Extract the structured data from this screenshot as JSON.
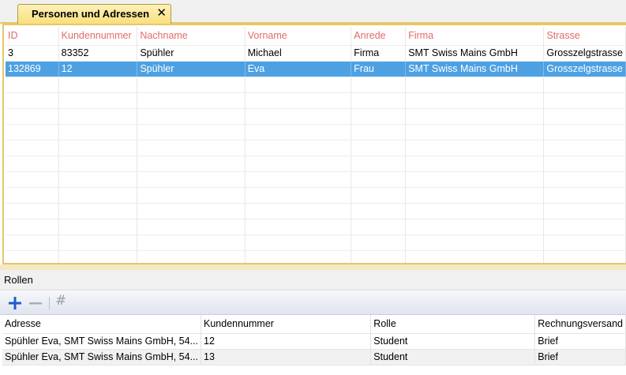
{
  "tab": {
    "title": "Personen und Adressen",
    "close_glyph": "✕"
  },
  "main_grid": {
    "columns": [
      "ID",
      "Kundennummer",
      "Nachname",
      "Vorname",
      "Anrede",
      "Firma",
      "Strasse"
    ],
    "rows": [
      [
        "3",
        "83352",
        "Spühler",
        "Michael",
        "Firma",
        "SMT Swiss Mains GmbH",
        "Grosszelgstrasse"
      ],
      [
        "132869",
        "12",
        "Spühler",
        "Eva",
        "Frau",
        "SMT Swiss Mains GmbH",
        "Grosszelgstrasse"
      ]
    ],
    "selected_row": 1
  },
  "roles_panel": {
    "title": "Rollen",
    "toolbar": {
      "add_icon": "plus-icon",
      "remove_icon": "minus-icon",
      "hash_icon": "hash-icon",
      "hash_glyph": "#"
    },
    "columns": [
      "Adresse",
      "Kundennummer",
      "Rolle",
      "Rechnungsversand"
    ],
    "rows": [
      [
        "Spühler Eva, SMT Swiss Mains GmbH, 54...",
        "12",
        "Student",
        "Brief"
      ],
      [
        "Spühler Eva, SMT Swiss Mains GmbH, 54...",
        "13",
        "Student",
        "Brief"
      ]
    ]
  },
  "colors": {
    "header_text": "#e06b68",
    "selection": "#4da1e3",
    "tab_gold": "#f9df7d",
    "add_blue": "#1f5ccc"
  }
}
